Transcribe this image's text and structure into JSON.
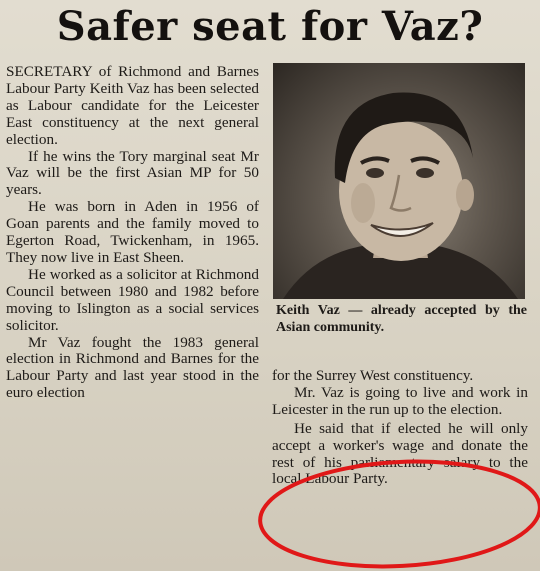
{
  "article": {
    "headline": "Safer seat for Vaz?",
    "left_column": [
      "SECRETARY of Richmond and Barnes Labour Party Keith Vaz has been selected as Labour candidate for the Leicester East constituency at the next general election.",
      "If he wins the Tory marginal seat Mr Vaz will be the first Asian MP for 50 years.",
      "He was born in Aden in 1956 of Goan parents and the family moved to Egerton Road, Twickenham, in 1965. They now live in East Sheen.",
      "He worked as a solicitor at Richmond Council between 1980 and 1982 before moving to Islington as a social services solicitor.",
      "Mr Vaz fought the 1983 general election in Richmond and Barnes for the Labour Party and last year stood in the euro election"
    ],
    "photo_caption": "Keith Vaz — already accepted by the Asian community.",
    "right_column": [
      "for the Surrey West constituency.",
      "Mr. Vaz is going to live and work in Leicester in the run up to the election.",
      "He said that if elected he will only accept a worker's wage and donate the rest of his parliamentary salary to the local Labour Party."
    ]
  },
  "annotation": {
    "shape": "ellipse",
    "color": "#e01818"
  },
  "photo": {
    "subject": "portrait-photo"
  }
}
